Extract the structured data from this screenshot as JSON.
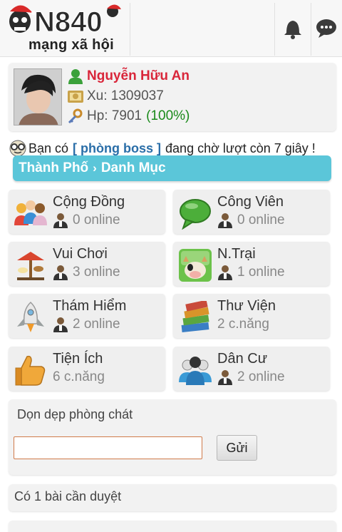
{
  "header": {
    "logo_text": "VN840",
    "logo_subtitle": "mạng xã hội",
    "icons": [
      "bell-icon",
      "chat-bubble-icon"
    ]
  },
  "profile": {
    "name": "Nguyễn Hữu An",
    "xu": "Xu: 1309037",
    "hp": "Hp: 7901",
    "hp_percent": "(100%)",
    "colors": {
      "name": "#d9263a",
      "hp_percent": "#1a8a1a"
    }
  },
  "notice": {
    "prefix": "Bạn có",
    "link": "[ phòng boss ]",
    "suffix": "đang chờ lượt còn 7 giây !"
  },
  "breadcrumb": {
    "city": "Thành Phố",
    "separator": "›",
    "category": "Danh Mục",
    "color": "#5bc6d9"
  },
  "categories": [
    {
      "name": "Cộng Đồng",
      "status": "0 online",
      "icon": "community-icon"
    },
    {
      "name": "Công Viên",
      "status": "0 online",
      "icon": "park-speech-icon"
    },
    {
      "name": "Vui Chơi",
      "status": "3 online",
      "icon": "carousel-icon"
    },
    {
      "name": "N.Trại",
      "status": "1 online",
      "icon": "farm-cow-icon"
    },
    {
      "name": "Thám Hiểm",
      "status": "2 online",
      "icon": "rocket-icon"
    },
    {
      "name": "Thư Viện",
      "status": "2 c.năng",
      "icon": "books-icon"
    },
    {
      "name": "Tiện Ích",
      "status": "6 c.năng",
      "icon": "thumbs-up-icon"
    },
    {
      "name": "Dân Cư",
      "status": "2 online",
      "icon": "residents-icon"
    }
  ],
  "cleanup": {
    "title": "Dọn dẹp phòng chát",
    "input_value": "",
    "button_label": "Gửi"
  },
  "pending": {
    "text": "Có 1 bài cần duyệt"
  }
}
